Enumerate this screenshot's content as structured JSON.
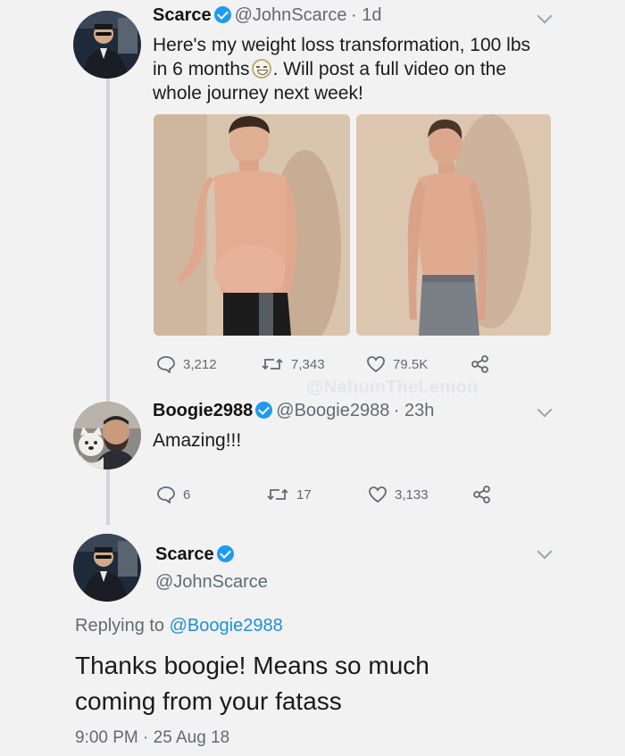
{
  "tweet1": {
    "name": "Scarce",
    "handle": "@JohnScarce",
    "time": "· 1d",
    "text_part1": "Here's my weight loss transformation, 100 lbs in 6 months",
    "text_part2": ". Will post a full video on the whole journey next week!",
    "replies": "3,212",
    "retweets": "7,343",
    "likes": "79.5K"
  },
  "watermark": "@NahumTheLemon",
  "tweet2": {
    "name": "Boogie2988",
    "handle": "@Boogie2988",
    "time": "· 23h",
    "text": "Amazing!!!",
    "replies": "6",
    "retweets": "17",
    "likes": "3,133"
  },
  "tweet3": {
    "name": "Scarce",
    "handle": "@JohnScarce",
    "replying_prefix": "Replying to",
    "replying_to": "@Boogie2988",
    "text": "Thanks boogie! Means so much coming from your fatass",
    "timestamp": "9:00 PM · 25 Aug 18"
  },
  "colors": {
    "background": "#f2f2f2",
    "verified": "#1d9bf0",
    "link": "#1d8fe0",
    "muted": "#5f6b75"
  }
}
